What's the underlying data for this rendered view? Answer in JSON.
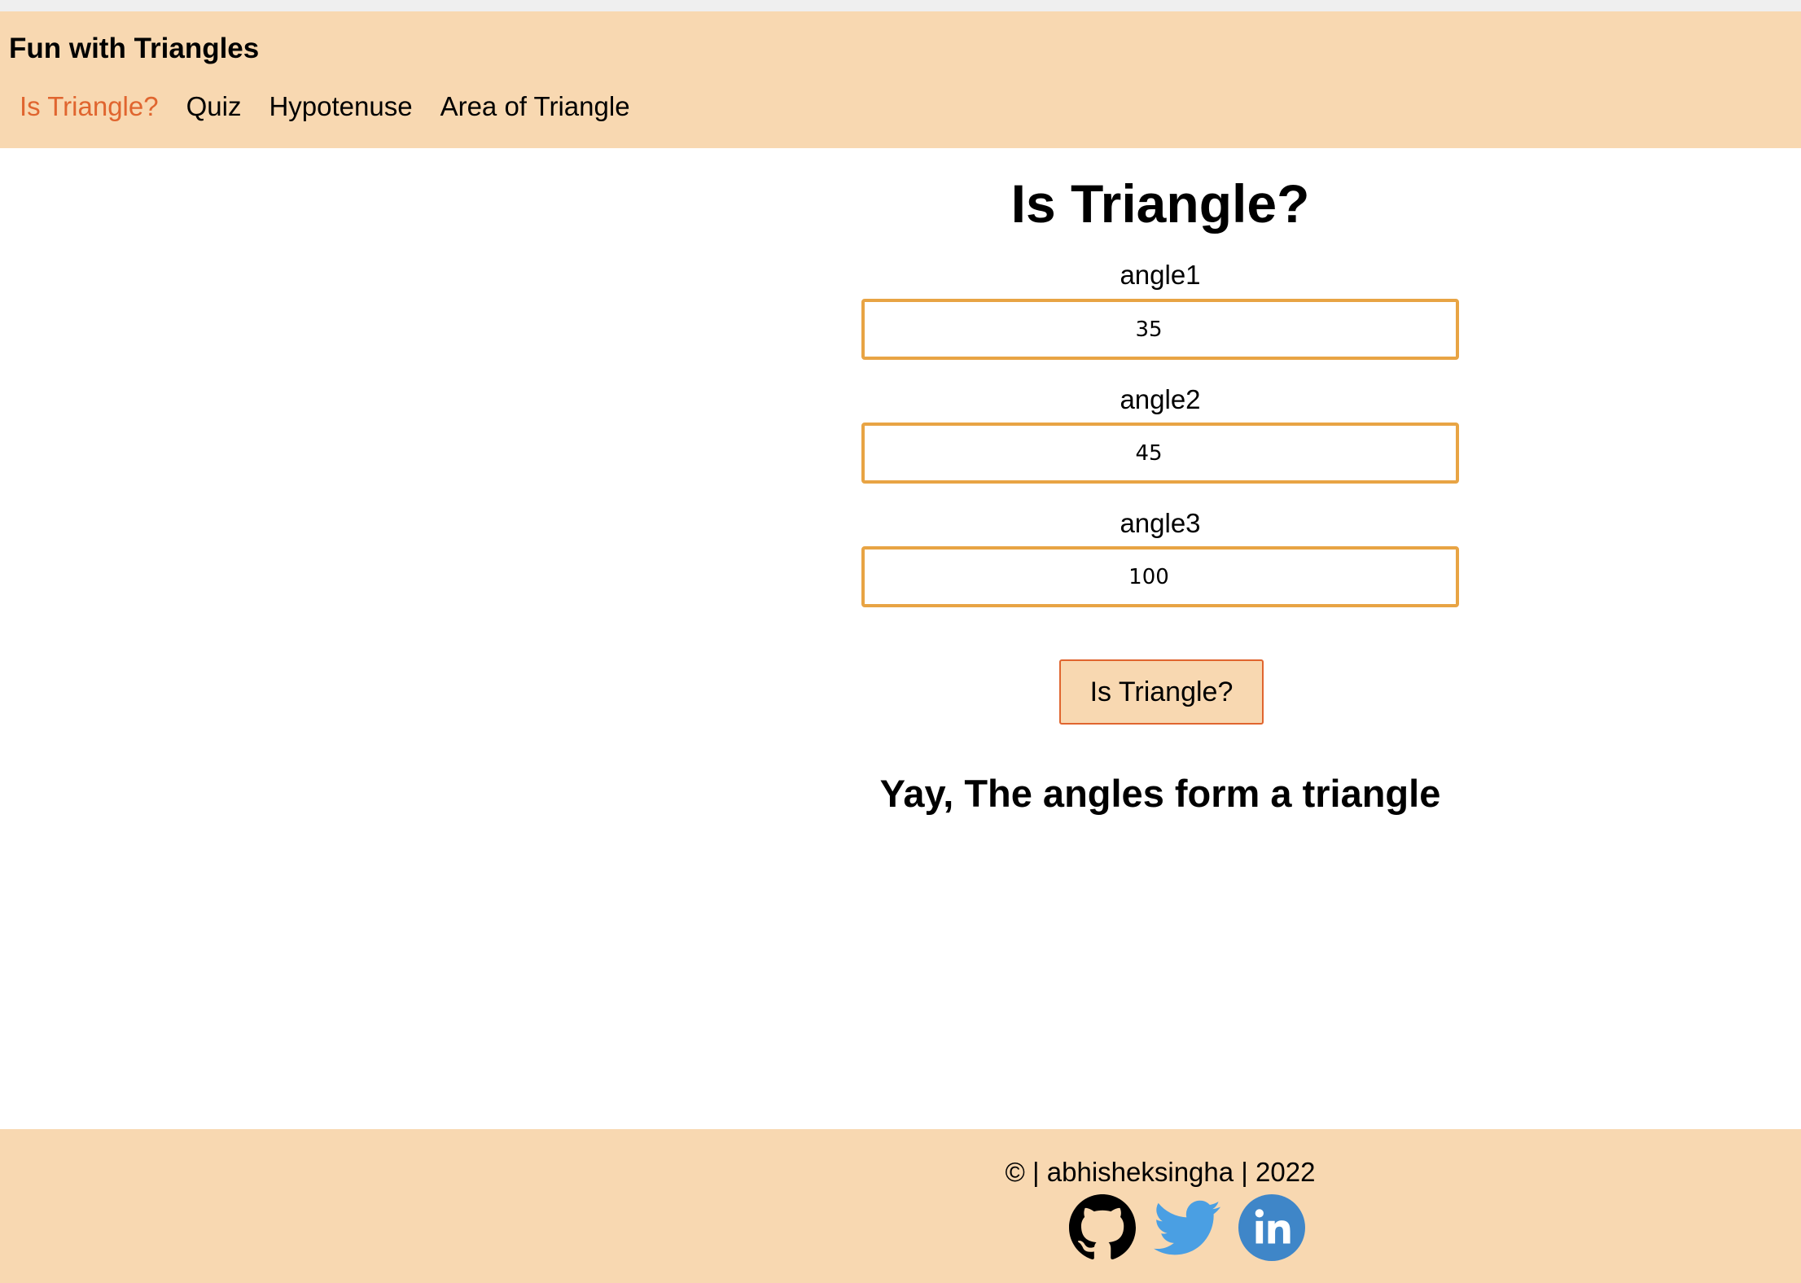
{
  "header": {
    "brand": "Fun with Triangles",
    "nav": [
      {
        "label": "Is Triangle?",
        "active": true
      },
      {
        "label": "Quiz",
        "active": false
      },
      {
        "label": "Hypotenuse",
        "active": false
      },
      {
        "label": "Area of Triangle",
        "active": false
      }
    ]
  },
  "main": {
    "title": "Is Triangle?",
    "fields": [
      {
        "label": "angle1",
        "value": "35"
      },
      {
        "label": "angle2",
        "value": "45"
      },
      {
        "label": "angle3",
        "value": "100"
      }
    ],
    "button_label": "Is Triangle?",
    "result": "Yay, The angles form a triangle"
  },
  "footer": {
    "text": "© | abhisheksingha | 2022",
    "social_icons": [
      "github-icon",
      "twitter-icon",
      "linkedin-icon"
    ]
  },
  "colors": {
    "header_bg": "#f8d8b1",
    "active_link": "#e0652f",
    "input_border": "#e8a444",
    "button_border": "#e0652f",
    "twitter": "#4a9fe3",
    "linkedin": "#3f86c8"
  }
}
